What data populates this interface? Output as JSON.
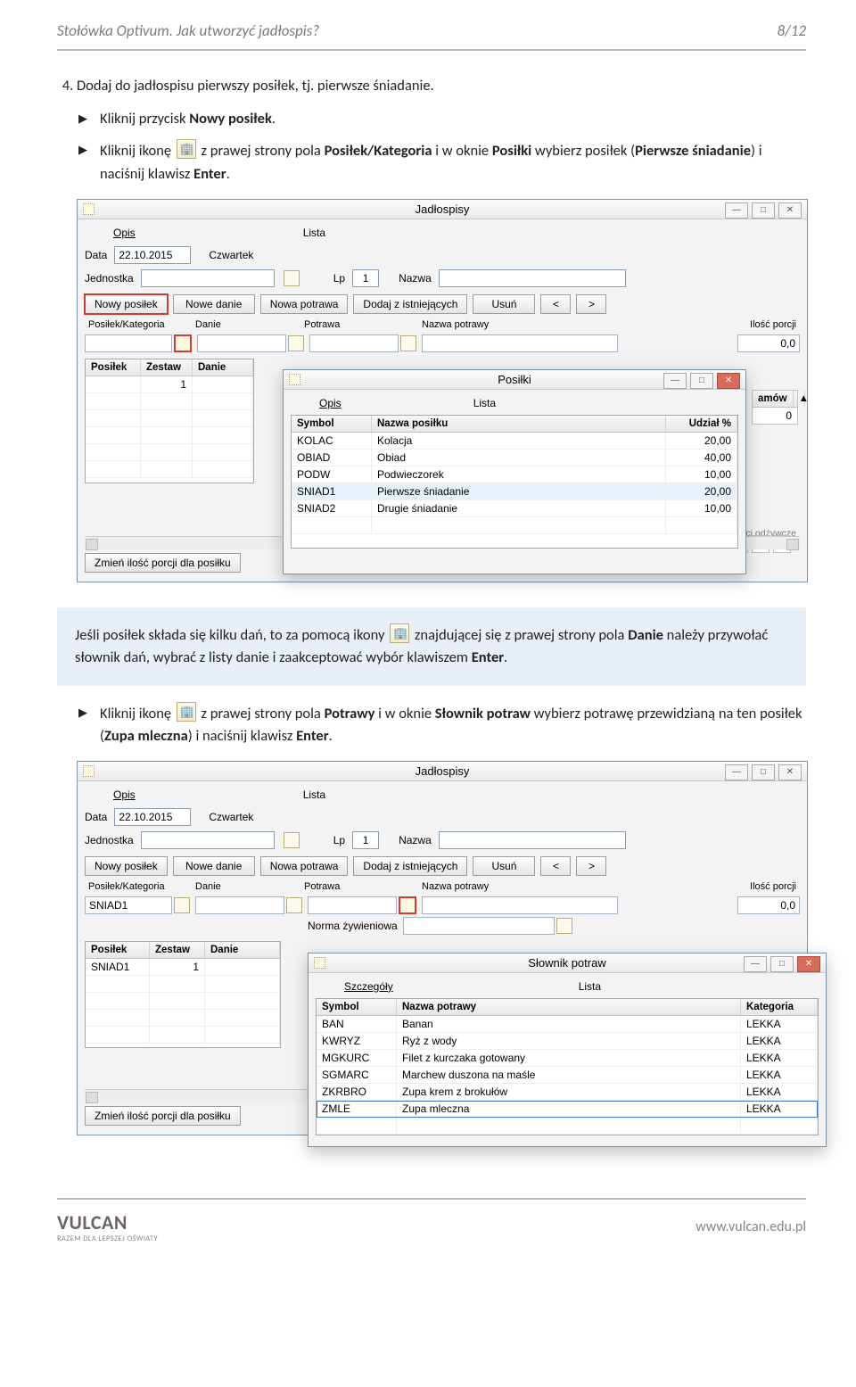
{
  "header": {
    "title": "Stołówka Optivum. Jak utworzyć jadłospis?",
    "page": "8/12"
  },
  "steps": {
    "num": "4.",
    "s1": "Dodaj do jadłospisu pierwszy posiłek, tj. pierwsze śniadanie.",
    "b1a": "Kliknij przycisk ",
    "b1b": "Nowy posiłek",
    "b1c": ".",
    "b2a": "Kliknij ikonę ",
    "b2b": " z prawej strony pola ",
    "b2c": "Posiłek/Kategoria",
    "b2d": " i w oknie ",
    "b2e": "Posiłki",
    "b2f": " wybierz posiłek (",
    "b2g": "Pierwsze śniadanie",
    "b2h": ") i naciśnij klawisz ",
    "b2i": "Enter",
    "b2j": "."
  },
  "note": {
    "t1": "Jeśli posiłek składa się kilku dań, to za pomocą ikony ",
    "t2": " znajdującej się z prawej strony pola ",
    "t3": "Danie",
    "t4": " należy przywołać słownik dań, wybrać z listy danie i zaakceptować wybór klawiszem ",
    "t5": "Enter",
    "t6": "."
  },
  "sub3": {
    "a": "Kliknij ikonę ",
    "b": " z prawej strony pola ",
    "c": "Potrawy",
    "d": " i w oknie ",
    "e": "Słownik potraw",
    "f": " wybierz potrawę przewidzianą na ten posiłek (",
    "g": "Zupa mleczna",
    "h": ") i naciśnij klawisz ",
    "i": "Enter",
    "j": "."
  },
  "win1": {
    "title": "Jadłospisy",
    "tabs": {
      "opis": "Opis",
      "lista": "Lista"
    },
    "form": {
      "data_lbl": "Data",
      "data_val": "22.10.2015",
      "day": "Czwartek",
      "jedn_lbl": "Jednostka",
      "lp_lbl": "Lp",
      "lp_val": "1",
      "nazwa_lbl": "Nazwa"
    },
    "btns": {
      "nowy_posilek": "Nowy posiłek",
      "nowe_danie": "Nowe danie",
      "nowa_potrawa": "Nowa potrawa",
      "dodaj": "Dodaj z istniejących",
      "usun": "Usuń",
      "lt": "<",
      "gt": ">"
    },
    "cols": {
      "posilek_kat": "Posiłek/Kategoria",
      "danie": "Danie",
      "potrawa": "Potrawa",
      "nazwa_potrawy": "Nazwa potrawy",
      "ilosc": "Ilość porcji"
    },
    "ilosc_val": "0,0",
    "grid": {
      "h_posilek": "Posiłek",
      "h_zestaw": "Zestaw",
      "h_danie": "Danie",
      "h_amow": "amów",
      "r1_zestaw": "1",
      "r1_amow": "0"
    },
    "footer_btn": "Zmień ilość porcji dla posiłku",
    "faint": "Wartości odżywcze"
  },
  "posilki": {
    "title": "Posiłki",
    "tabs": {
      "opis": "Opis",
      "lista": "Lista"
    },
    "h": {
      "symbol": "Symbol",
      "nazwa": "Nazwa posiłku",
      "udzial": "Udział %"
    },
    "rows": [
      {
        "sym": "KOLAC",
        "naz": "Kolacja",
        "u": "20,00"
      },
      {
        "sym": "OBIAD",
        "naz": "Obiad",
        "u": "40,00"
      },
      {
        "sym": "PODW",
        "naz": "Podwieczorek",
        "u": "10,00"
      },
      {
        "sym": "SNIAD1",
        "naz": "Pierwsze śniadanie",
        "u": "20,00"
      },
      {
        "sym": "SNIAD2",
        "naz": "Drugie śniadanie",
        "u": "10,00"
      }
    ]
  },
  "win2_extra": {
    "row_sniad1": "SNIAD1",
    "norma": "Norma żywieniowa"
  },
  "slownik": {
    "title": "Słownik potraw",
    "tabs": {
      "szczegoly": "Szczegóły",
      "lista": "Lista"
    },
    "h": {
      "symbol": "Symbol",
      "nazwa": "Nazwa  potrawy",
      "kat": "Kategoria"
    },
    "rows": [
      {
        "sym": "BAN",
        "naz": "Banan",
        "kat": "LEKKA"
      },
      {
        "sym": "KWRYZ",
        "naz": "Ryż z wody",
        "kat": "LEKKA"
      },
      {
        "sym": "MGKURC",
        "naz": "Filet z kurczaka gotowany",
        "kat": "LEKKA"
      },
      {
        "sym": "SGMARC",
        "naz": "Marchew duszona na maśle",
        "kat": "LEKKA"
      },
      {
        "sym": "ZKRBRO",
        "naz": "Zupa krem z brokułów",
        "kat": "LEKKA"
      },
      {
        "sym": "ZMLE",
        "naz": "Zupa mleczna",
        "kat": "LEKKA"
      }
    ]
  },
  "footer": {
    "brand": "VULCAN",
    "tag": "RAZEM DLA LEPSZEJ OŚWIATY",
    "site": "www.vulcan.edu.pl"
  }
}
